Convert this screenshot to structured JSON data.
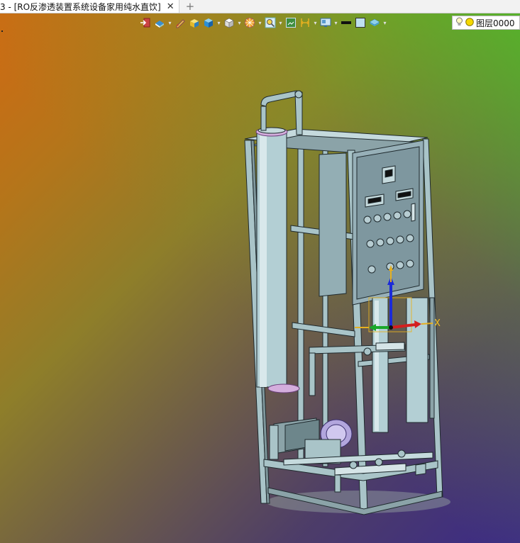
{
  "tab": {
    "title": "3 - [RO反渗透装置系统设备家用纯水直饮]",
    "close_glyph": "✕",
    "new_glyph": "+"
  },
  "toolbar": {
    "icons": [
      "exit-icon",
      "view-cube-icon",
      "sketch-pen-icon",
      "solid-box-yellow-icon",
      "solid-box-blue-icon",
      "white-cube-icon",
      "render-sphere-icon",
      "zoom-icon",
      "image-icon",
      "dimension-icon",
      "display-mode-icon",
      "line-color-icon",
      "fill-color-icon",
      "layer-stack-icon"
    ]
  },
  "layer_control": {
    "label": "图层0000",
    "bulb": "lightbulb-icon"
  },
  "gizmo": {
    "x_label": "X"
  },
  "colors": {
    "accent_yellow": "#f5d800",
    "frame": "#a9c4c8",
    "panel": "#8ea6b0"
  }
}
